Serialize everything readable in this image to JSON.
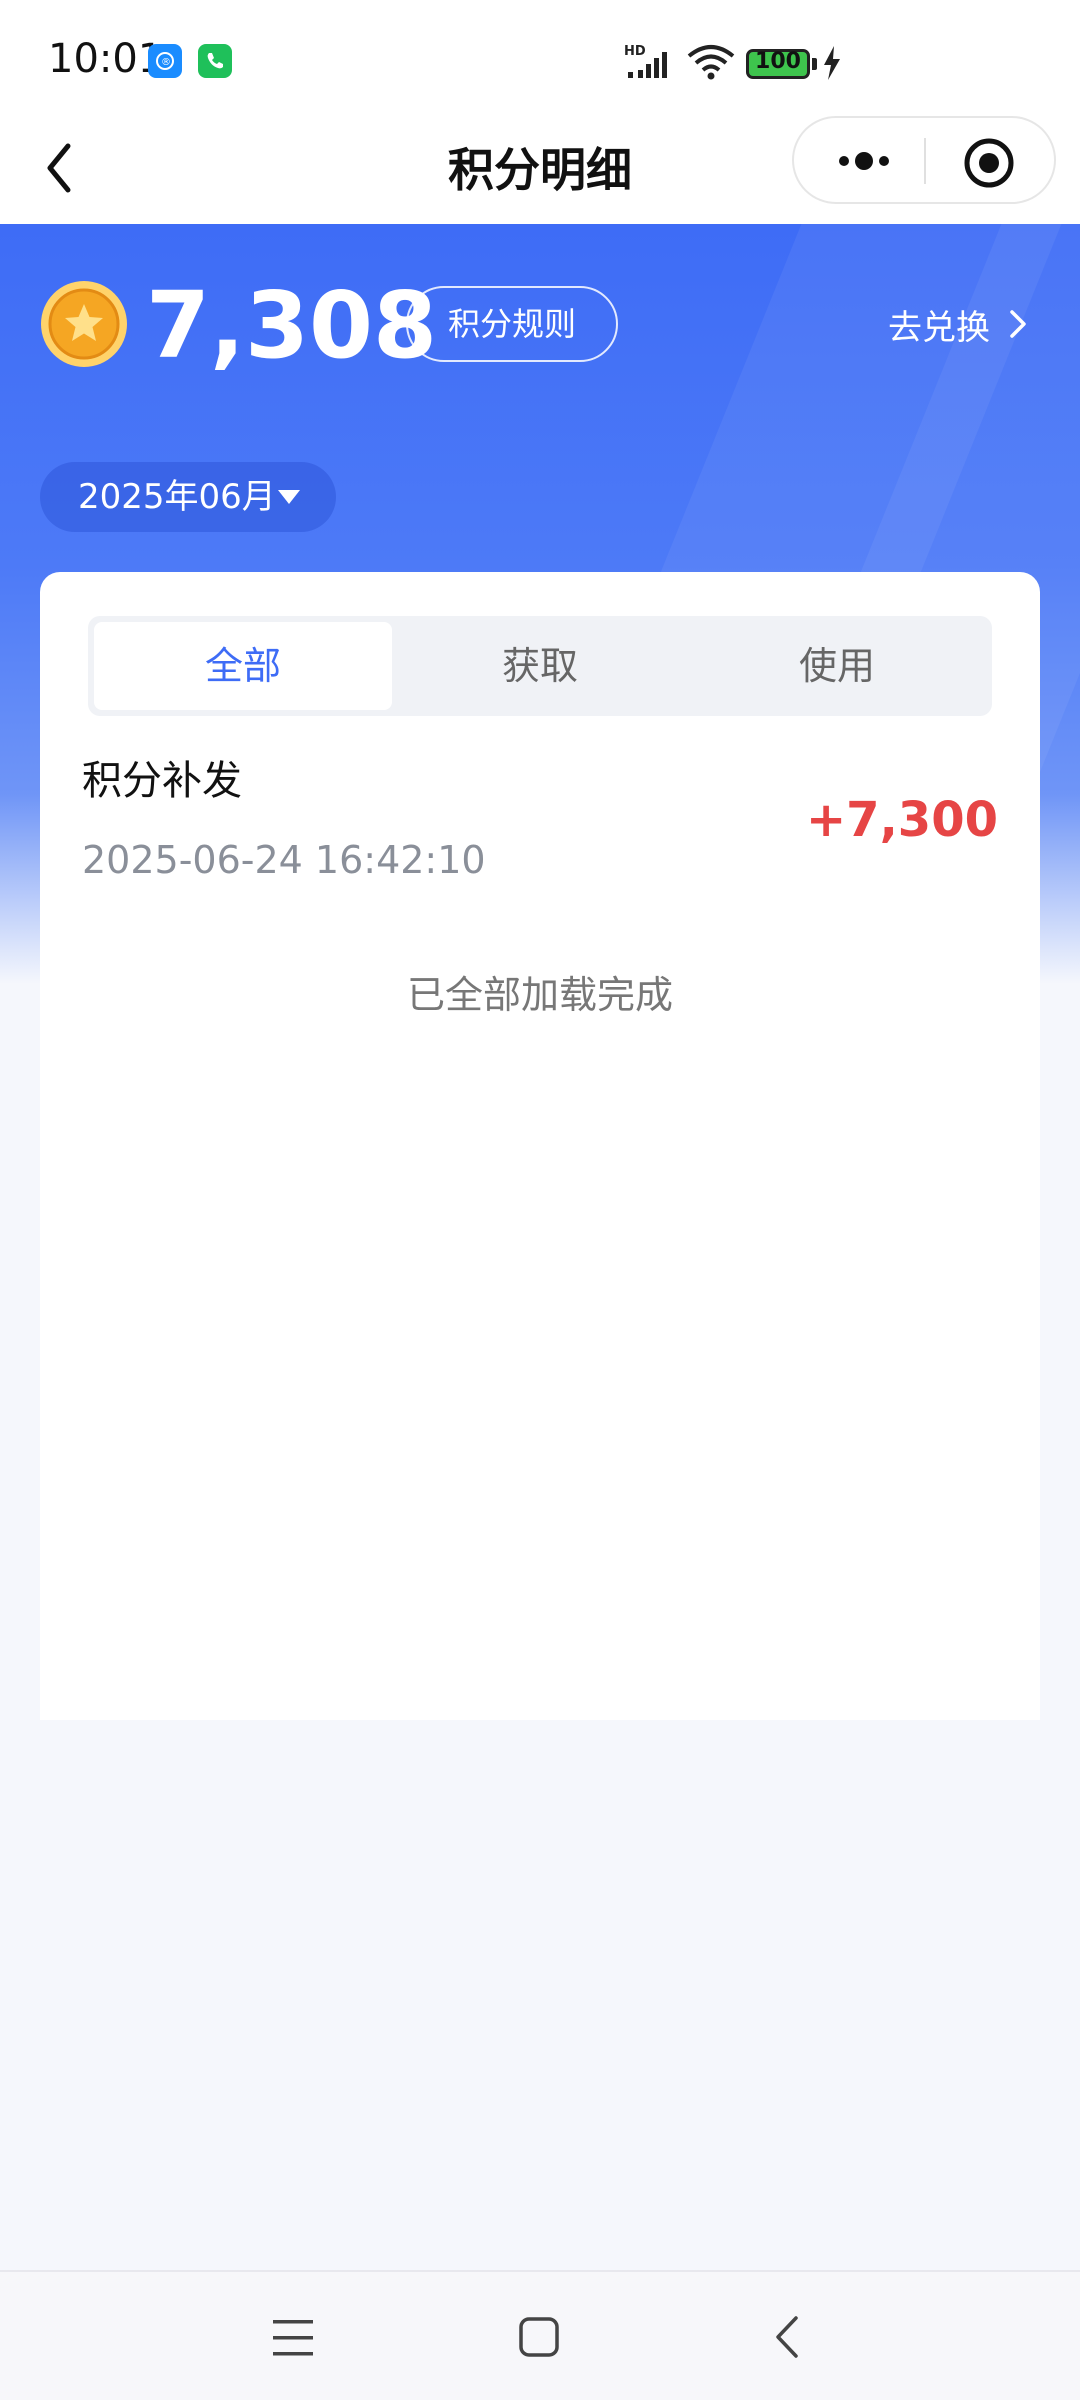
{
  "status_bar": {
    "time": "10:01",
    "battery": "100",
    "network": "HD"
  },
  "nav": {
    "title": "积分明细"
  },
  "header": {
    "points_total": "7,308",
    "rules_label": "积分规则",
    "exchange_label": "去兑换",
    "month": "2025年06月"
  },
  "tabs": [
    {
      "label": "全部",
      "active": true
    },
    {
      "label": "获取",
      "active": false
    },
    {
      "label": "使用",
      "active": false
    }
  ],
  "records": [
    {
      "title": "积分补发",
      "time": "2025-06-24 16:42:10",
      "amount": "+7,300"
    }
  ],
  "list_footer": "已全部加载完成",
  "colors": {
    "brand_blue": "#3e6cf6",
    "amount_red": "#e64545",
    "coin_gold": "#f5a623"
  },
  "icons": {
    "back": "chevron-left-icon",
    "more": "more-dots-icon",
    "close": "target-icon",
    "coin": "coin-star-icon",
    "exchange": "chevron-right-icon",
    "month": "caret-down-icon"
  }
}
